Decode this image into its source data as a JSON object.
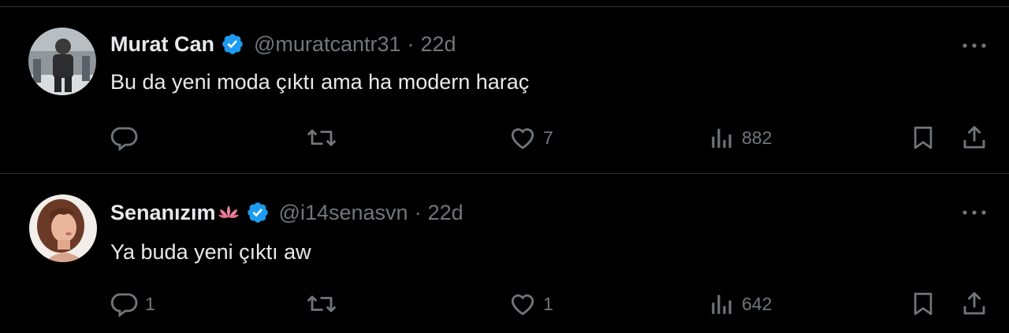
{
  "colors": {
    "background": "#000000",
    "text_primary": "#e7e9ea",
    "text_secondary": "#71767b",
    "divider": "#2f3336",
    "verified": "#1d9bf0"
  },
  "tweets": [
    {
      "display_name": "Murat Can",
      "handle": "@muratcantr31",
      "separator": "·",
      "time": "22d",
      "text": "Bu da yeni moda çıktı ama ha modern haraç",
      "replies": "",
      "retweets": "",
      "likes": "7",
      "views": "882"
    },
    {
      "display_name": "Senanızım",
      "handle": "@i14senasvn",
      "separator": "·",
      "time": "22d",
      "text": "Ya buda yeni çıktı aw",
      "replies": "1",
      "retweets": "",
      "likes": "1",
      "views": "642"
    }
  ],
  "icons": {
    "verified": "verified-badge-icon",
    "more": "more-icon",
    "reply": "reply-icon",
    "retweet": "retweet-icon",
    "like": "heart-icon",
    "views": "views-icon",
    "bookmark": "bookmark-icon",
    "share": "share-icon",
    "emoji": "lotus-emoji-icon"
  }
}
